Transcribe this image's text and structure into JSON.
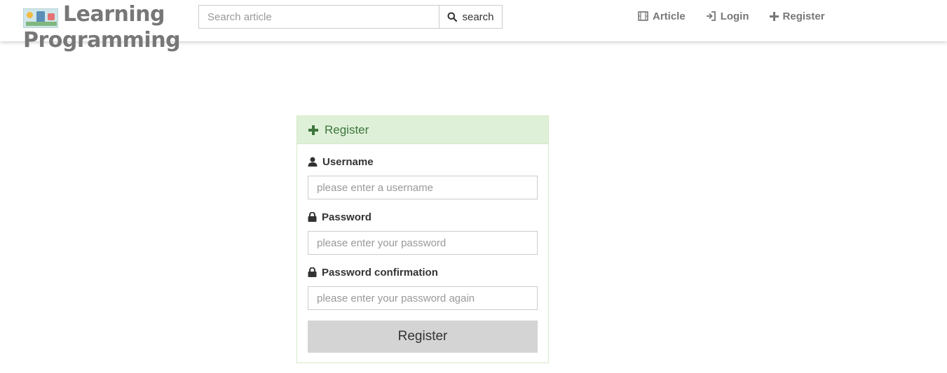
{
  "brand": {
    "line1": "Learning",
    "line2": "Programming",
    "logo": "learning-logo"
  },
  "search": {
    "placeholder": "Search article",
    "button_label": "search",
    "icon": "search-icon"
  },
  "nav": [
    {
      "label": "Article",
      "icon": "film-icon"
    },
    {
      "label": "Login",
      "icon": "login-icon"
    },
    {
      "label": "Register",
      "icon": "plus-icon"
    }
  ],
  "form": {
    "title": "Register",
    "title_icon": "plus-icon",
    "fields": [
      {
        "label": "Username",
        "icon": "user-icon",
        "placeholder": "please enter a username",
        "value": ""
      },
      {
        "label": "Password",
        "icon": "lock-icon",
        "placeholder": "please enter your password",
        "value": ""
      },
      {
        "label": "Password confirmation",
        "icon": "lock-icon",
        "placeholder": "please enter your password again",
        "value": ""
      }
    ],
    "submit_label": "Register"
  },
  "colors": {
    "panel_heading_bg": "#dff0d8",
    "panel_heading_text": "#3c763d",
    "panel_border": "#d6e9c6",
    "nav_text": "#777777",
    "submit_bg": "#d4d4d4"
  }
}
